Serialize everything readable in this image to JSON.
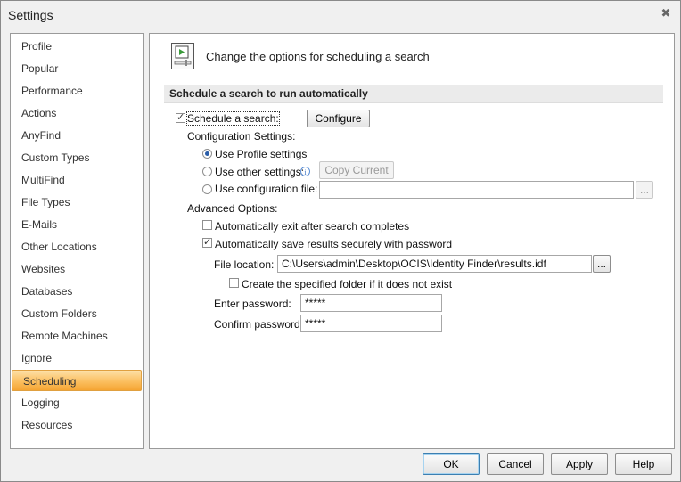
{
  "window": {
    "title": "Settings",
    "close_glyph": "✖"
  },
  "sidebar": {
    "items": [
      {
        "label": "Profile",
        "active": false
      },
      {
        "label": "Popular",
        "active": false
      },
      {
        "label": "Performance",
        "active": false
      },
      {
        "label": "Actions",
        "active": false
      },
      {
        "label": "AnyFind",
        "active": false
      },
      {
        "label": "Custom Types",
        "active": false
      },
      {
        "label": "MultiFind",
        "active": false
      },
      {
        "label": "File Types",
        "active": false
      },
      {
        "label": "E-Mails",
        "active": false
      },
      {
        "label": "Other Locations",
        "active": false
      },
      {
        "label": "Websites",
        "active": false
      },
      {
        "label": "Databases",
        "active": false
      },
      {
        "label": "Custom Folders",
        "active": false
      },
      {
        "label": "Remote Machines",
        "active": false
      },
      {
        "label": "Ignore",
        "active": false
      },
      {
        "label": "Scheduling",
        "active": true
      },
      {
        "label": "Logging",
        "active": false
      },
      {
        "label": "Resources",
        "active": false
      }
    ]
  },
  "main": {
    "header_text": "Change the options for scheduling a search",
    "header_icon": "schedule-icon",
    "section_title": "Schedule a search to run automatically",
    "schedule_checkbox": {
      "label": "Schedule a search:",
      "checked": true
    },
    "configure_button": "Configure",
    "config_settings_label": "Configuration Settings:",
    "radio_profile": {
      "label": "Use Profile settings",
      "selected": true
    },
    "radio_other": {
      "label": "Use other settings:",
      "selected": false
    },
    "info_glyph": "i",
    "copy_current_button": "Copy Current",
    "radio_config_file": {
      "label": "Use configuration file:",
      "selected": false
    },
    "config_file_value": "",
    "browse_glyph": "...",
    "advanced_label": "Advanced Options:",
    "auto_exit": {
      "label": "Automatically exit after search completes",
      "checked": false
    },
    "auto_save": {
      "label": "Automatically save results securely with password",
      "checked": true
    },
    "file_location_label": "File location:",
    "file_location_value": "C:\\Users\\admin\\Desktop\\OCIS\\Identity Finder\\results.idf",
    "create_folder": {
      "label": "Create the specified folder if it does not exist",
      "checked": false
    },
    "enter_password_label": "Enter password:",
    "enter_password_value": "*****",
    "confirm_password_label": "Confirm password:",
    "confirm_password_value": "*****"
  },
  "footer": {
    "ok": "OK",
    "cancel": "Cancel",
    "apply": "Apply",
    "help": "Help"
  }
}
